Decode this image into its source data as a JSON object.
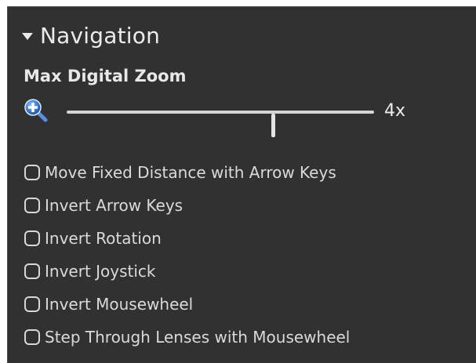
{
  "section": {
    "title": "Navigation",
    "expanded": true,
    "caret_icon": "caret-down-icon"
  },
  "zoom": {
    "label": "Max Digital Zoom",
    "icon": "zoom-in-icon",
    "value_label": "4x",
    "slider_fraction": 0.67
  },
  "options": [
    {
      "label": "Move Fixed Distance with Arrow Keys",
      "checked": false
    },
    {
      "label": "Invert Arrow Keys",
      "checked": false
    },
    {
      "label": "Invert Rotation",
      "checked": false
    },
    {
      "label": "Invert Joystick",
      "checked": false
    },
    {
      "label": "Invert Mousewheel",
      "checked": false
    },
    {
      "label": "Step Through Lenses with Mousewheel",
      "checked": false
    }
  ],
  "colors": {
    "panel_background": "#313131",
    "text": "#e6e6e6",
    "icon_blue": "#2f6fc4"
  }
}
